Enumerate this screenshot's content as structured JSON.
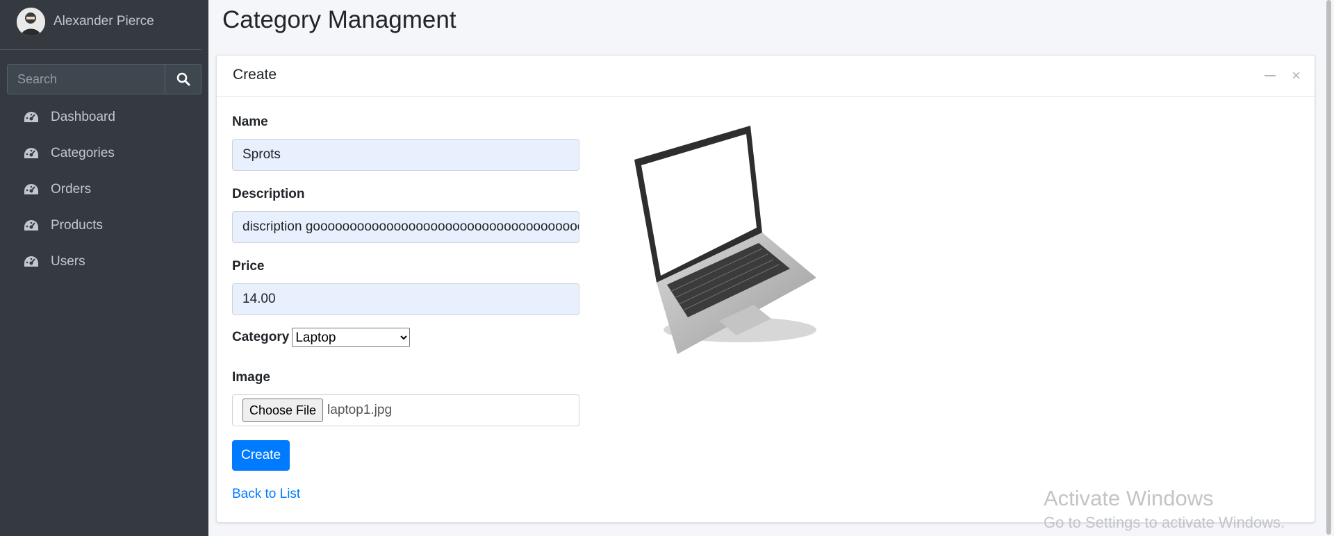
{
  "user": {
    "name": "Alexander Pierce"
  },
  "search": {
    "placeholder": "Search"
  },
  "sidebar": {
    "items": [
      {
        "label": "Dashboard",
        "icon": "tachometer-icon"
      },
      {
        "label": "Categories",
        "icon": "tachometer-icon"
      },
      {
        "label": "Orders",
        "icon": "tachometer-icon"
      },
      {
        "label": "Products",
        "icon": "tachometer-icon"
      },
      {
        "label": "Users",
        "icon": "tachometer-icon"
      }
    ]
  },
  "page": {
    "title": "Category Managment"
  },
  "card": {
    "title": "Create",
    "form": {
      "name_label": "Name",
      "name_value": "Sprots",
      "description_label": "Description",
      "description_value": "discription gooooooooooooooooooooooooooooooooooooo",
      "price_label": "Price",
      "price_value": "14.00",
      "category_label": "Category",
      "category_selected": "Laptop",
      "image_label": "Image",
      "file_button": "Choose File",
      "file_name": "laptop1.jpg",
      "submit_label": "Create",
      "back_link": "Back to List"
    }
  },
  "watermark": {
    "line1": "Activate Windows",
    "line2": "Go to Settings to activate Windows."
  },
  "colors": {
    "sidebar_bg": "#343a40",
    "primary": "#007bff",
    "autofill_bg": "#e8f0fe"
  }
}
